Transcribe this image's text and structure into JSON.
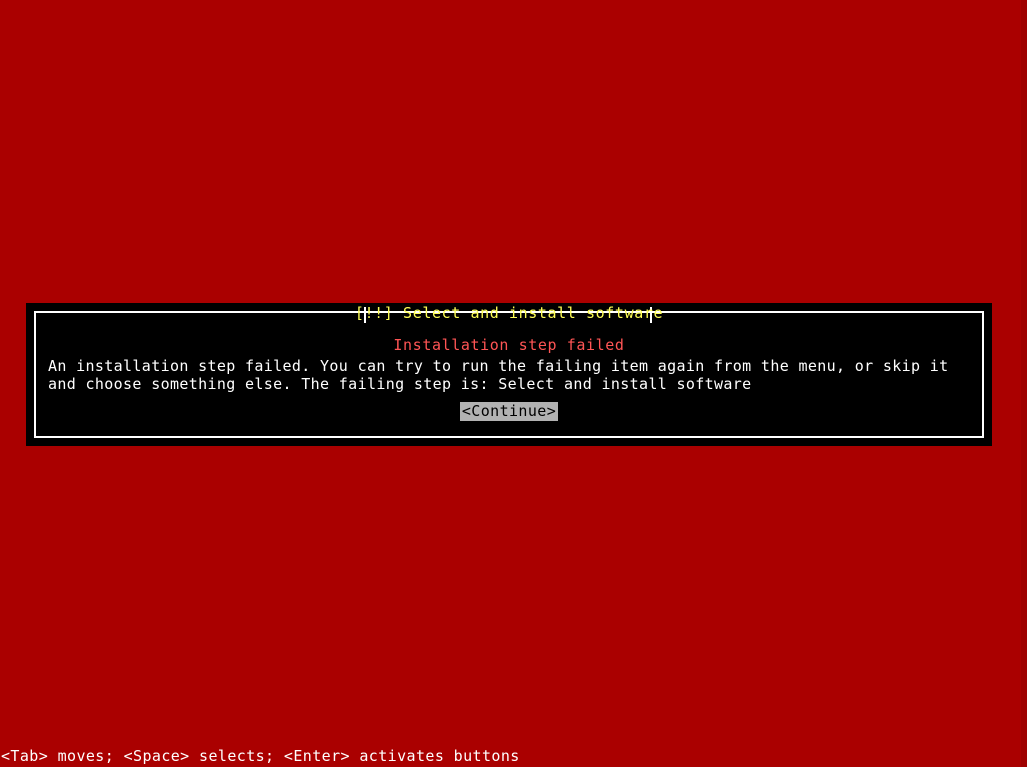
{
  "screen": {
    "background_color": "#aa0000",
    "foreground_color": "#ffffff"
  },
  "dialog": {
    "title": "[!!] Select and install software",
    "title_color": "#ffff55",
    "background_color": "#000000",
    "border_color": "#ffffff",
    "heading": "Installation step failed",
    "heading_color": "#ff5555",
    "body": "An installation step failed. You can try to run the failing item again from the menu, or skip it and choose something else. The failing step is: Select and install software",
    "buttons": [
      {
        "label": "<Continue>",
        "selected": true,
        "background_color": "#b2b2b2",
        "text_color": "#000000"
      }
    ]
  },
  "status_bar": {
    "text": "<Tab> moves; <Space> selects; <Enter> activates buttons"
  }
}
